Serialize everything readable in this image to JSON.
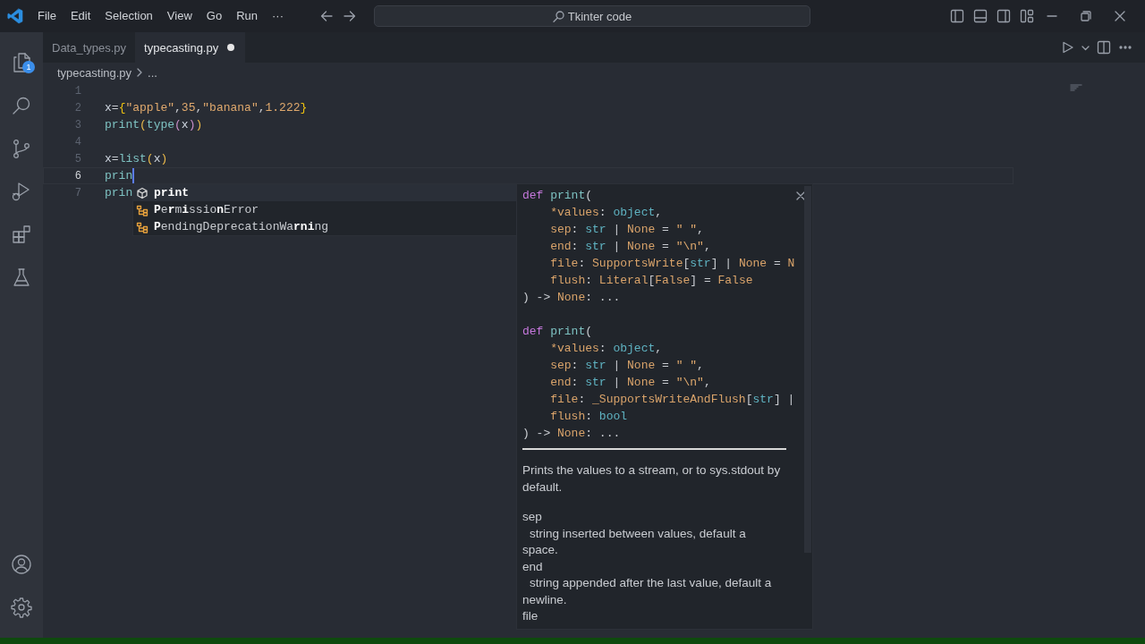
{
  "title_bar": {
    "menu": [
      "File",
      "Edit",
      "Selection",
      "View",
      "Go",
      "Run"
    ],
    "more": "···",
    "command_center": {
      "text": "Tkinter code"
    }
  },
  "activity_bar": {
    "items": [
      {
        "kind": "files",
        "badge": "1"
      },
      {
        "kind": "search"
      },
      {
        "kind": "source-control"
      },
      {
        "kind": "run-debug"
      },
      {
        "kind": "extensions"
      },
      {
        "kind": "testing"
      }
    ],
    "bottom": [
      {
        "kind": "account"
      },
      {
        "kind": "settings"
      }
    ]
  },
  "tabs": [
    {
      "label": "Data_types.py",
      "selected": false,
      "modified": false
    },
    {
      "label": "typecasting.py",
      "selected": true,
      "modified": true
    }
  ],
  "breadcrumbs": [
    "typecasting.py",
    "..."
  ],
  "editor": {
    "lines": [
      {
        "number": "1",
        "current": false
      },
      {
        "number": "2",
        "current": false,
        "tokens": [
          {
            "t": "x",
            "kind": "var"
          },
          {
            "t": "=",
            "kind": "op"
          },
          {
            "t": "{",
            "kind": "brace"
          },
          {
            "t": "\"apple\"",
            "kind": "str"
          },
          {
            "t": ",",
            "kind": "op"
          },
          {
            "t": "35",
            "kind": "num"
          },
          {
            "t": ",",
            "kind": "op"
          },
          {
            "t": "\"banana\"",
            "kind": "str"
          },
          {
            "t": ",",
            "kind": "op"
          },
          {
            "t": "1.222",
            "kind": "num"
          },
          {
            "t": "}",
            "kind": "brace"
          }
        ]
      },
      {
        "number": "3",
        "current": false,
        "tokens": [
          {
            "t": "print",
            "kind": "func"
          },
          {
            "t": "(",
            "kind": "paren"
          },
          {
            "t": "type",
            "kind": "func"
          },
          {
            "t": "(",
            "kind": "paren2"
          },
          {
            "t": "x",
            "kind": "var"
          },
          {
            "t": ")",
            "kind": "paren2"
          },
          {
            "t": ")",
            "kind": "paren"
          }
        ]
      },
      {
        "number": "4",
        "current": false
      },
      {
        "number": "5",
        "current": false,
        "tokens": [
          {
            "t": "x",
            "kind": "var"
          },
          {
            "t": "=",
            "kind": "op"
          },
          {
            "t": "list",
            "kind": "func"
          },
          {
            "t": "(",
            "kind": "paren"
          },
          {
            "t": "x",
            "kind": "var"
          },
          {
            "t": ")",
            "kind": "paren"
          }
        ]
      },
      {
        "number": "6",
        "current": true,
        "cursor": true,
        "tokens": [
          {
            "t": "prin",
            "kind": "func"
          }
        ]
      },
      {
        "number": "7",
        "current": false,
        "tokens": [
          {
            "t": "prin",
            "kind": "func"
          }
        ]
      }
    ]
  },
  "suggestions": [
    {
      "kind": "method",
      "label": "**print**",
      "selected": true
    },
    {
      "kind": "class",
      "label": "**P**e**r**m**i**ssio**n**Error",
      "selected": false
    },
    {
      "kind": "class",
      "label": "**P**endingDeprecationWa**rni**ng",
      "selected": false
    }
  ],
  "hover": {
    "signatures": [
      [
        [
          {
            "t": "def ",
            "kind": "kw"
          },
          {
            "t": "print",
            "kind": "func"
          },
          {
            "t": "(",
            "kind": "plain"
          }
        ],
        [
          {
            "t": "    *values",
            "kind": "param"
          },
          {
            "t": ": ",
            "kind": "plain"
          },
          {
            "t": "object",
            "kind": "type"
          },
          {
            "t": ",",
            "kind": "plain"
          }
        ],
        [
          {
            "t": "    sep",
            "kind": "param"
          },
          {
            "t": ": ",
            "kind": "plain"
          },
          {
            "t": "str",
            "kind": "type"
          },
          {
            "t": " | ",
            "kind": "plain"
          },
          {
            "t": "None",
            "kind": "const"
          },
          {
            "t": " = ",
            "kind": "plain"
          },
          {
            "t": "\" \"",
            "kind": "str"
          },
          {
            "t": ",",
            "kind": "plain"
          }
        ],
        [
          {
            "t": "    end",
            "kind": "param"
          },
          {
            "t": ": ",
            "kind": "plain"
          },
          {
            "t": "str",
            "kind": "type"
          },
          {
            "t": " | ",
            "kind": "plain"
          },
          {
            "t": "None",
            "kind": "const"
          },
          {
            "t": " = ",
            "kind": "plain"
          },
          {
            "t": "\"\\n\"",
            "kind": "str"
          },
          {
            "t": ",",
            "kind": "plain"
          }
        ],
        [
          {
            "t": "    file",
            "kind": "param"
          },
          {
            "t": ": ",
            "kind": "plain"
          },
          {
            "t": "SupportsWrite",
            "kind": "const"
          },
          {
            "t": "[",
            "kind": "plain"
          },
          {
            "t": "str",
            "kind": "type"
          },
          {
            "t": "]",
            "kind": "plain"
          },
          {
            "t": " | ",
            "kind": "plain"
          },
          {
            "t": "None",
            "kind": "const"
          },
          {
            "t": " = ",
            "kind": "plain"
          },
          {
            "t": "N",
            "kind": "const"
          }
        ],
        [
          {
            "t": "    flush",
            "kind": "param"
          },
          {
            "t": ": ",
            "kind": "plain"
          },
          {
            "t": "Literal",
            "kind": "const"
          },
          {
            "t": "[",
            "kind": "plain"
          },
          {
            "t": "False",
            "kind": "const"
          },
          {
            "t": "]",
            "kind": "plain"
          },
          {
            "t": " = ",
            "kind": "plain"
          },
          {
            "t": "False",
            "kind": "const"
          }
        ],
        [
          {
            "t": ") -> ",
            "kind": "plain"
          },
          {
            "t": "None",
            "kind": "const"
          },
          {
            "t": ": ...",
            "kind": "plain"
          }
        ]
      ],
      [
        [
          {
            "t": "def ",
            "kind": "kw"
          },
          {
            "t": "print",
            "kind": "func"
          },
          {
            "t": "(",
            "kind": "plain"
          }
        ],
        [
          {
            "t": "    *values",
            "kind": "param"
          },
          {
            "t": ": ",
            "kind": "plain"
          },
          {
            "t": "object",
            "kind": "type"
          },
          {
            "t": ",",
            "kind": "plain"
          }
        ],
        [
          {
            "t": "    sep",
            "kind": "param"
          },
          {
            "t": ": ",
            "kind": "plain"
          },
          {
            "t": "str",
            "kind": "type"
          },
          {
            "t": " | ",
            "kind": "plain"
          },
          {
            "t": "None",
            "kind": "const"
          },
          {
            "t": " = ",
            "kind": "plain"
          },
          {
            "t": "\" \"",
            "kind": "str"
          },
          {
            "t": ",",
            "kind": "plain"
          }
        ],
        [
          {
            "t": "    end",
            "kind": "param"
          },
          {
            "t": ": ",
            "kind": "plain"
          },
          {
            "t": "str",
            "kind": "type"
          },
          {
            "t": " | ",
            "kind": "plain"
          },
          {
            "t": "None",
            "kind": "const"
          },
          {
            "t": " = ",
            "kind": "plain"
          },
          {
            "t": "\"\\n\"",
            "kind": "str"
          },
          {
            "t": ",",
            "kind": "plain"
          }
        ],
        [
          {
            "t": "    file",
            "kind": "param"
          },
          {
            "t": ": ",
            "kind": "plain"
          },
          {
            "t": "_SupportsWriteAndFlush",
            "kind": "const"
          },
          {
            "t": "[",
            "kind": "plain"
          },
          {
            "t": "str",
            "kind": "type"
          },
          {
            "t": "]",
            "kind": "plain"
          },
          {
            "t": " |",
            "kind": "plain"
          }
        ],
        [
          {
            "t": "    flush",
            "kind": "param"
          },
          {
            "t": ": ",
            "kind": "plain"
          },
          {
            "t": "bool",
            "kind": "type"
          }
        ],
        [
          {
            "t": ") -> ",
            "kind": "plain"
          },
          {
            "t": "None",
            "kind": "const"
          },
          {
            "t": ": ...",
            "kind": "plain"
          }
        ]
      ]
    ],
    "description": [
      {
        "kind": "para",
        "text": "Prints the values to a stream, or to sys.stdout by default."
      },
      {
        "kind": "term",
        "text": "sep"
      },
      {
        "kind": "def",
        "text": "string inserted between values, default a space."
      },
      {
        "kind": "term",
        "text": "end"
      },
      {
        "kind": "def",
        "text": "string appended after the last value, default a newline."
      },
      {
        "kind": "term",
        "text": "file"
      }
    ]
  }
}
